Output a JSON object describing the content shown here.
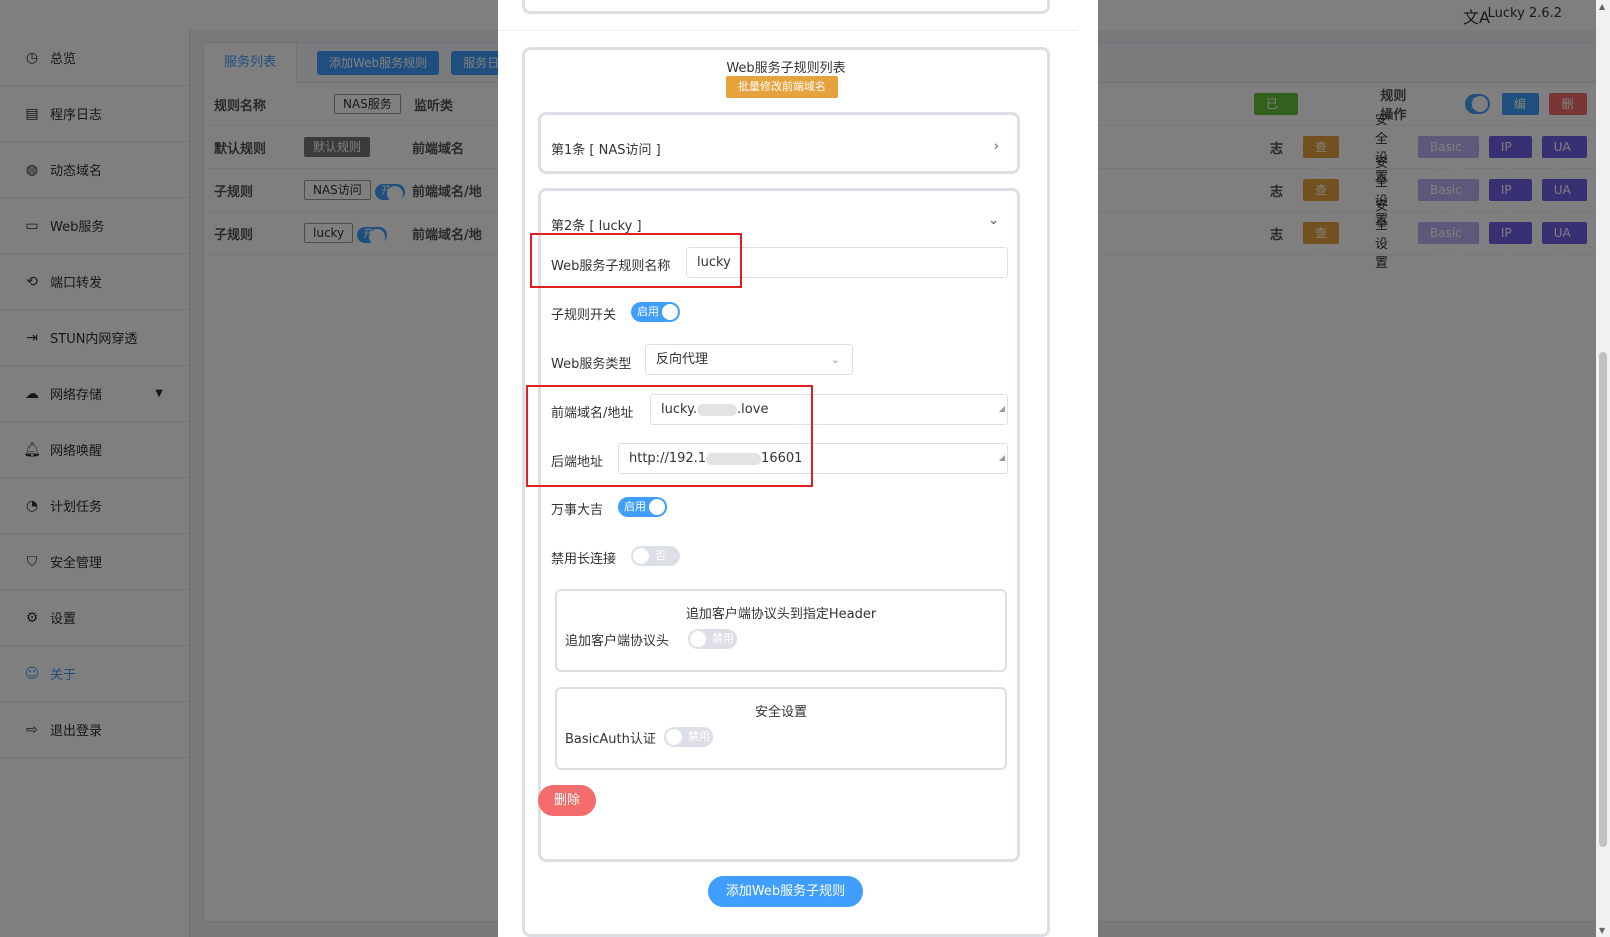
{
  "topbar": {
    "lang_icon": "translate-icon",
    "version": "Lucky 2.6.2"
  },
  "sidebar": {
    "items": [
      {
        "label": "总览",
        "icon": "dashboard-icon"
      },
      {
        "label": "程序日志",
        "icon": "log-icon"
      },
      {
        "label": "动态域名",
        "icon": "globe-icon"
      },
      {
        "label": "Web服务",
        "icon": "web-icon"
      },
      {
        "label": "端口转发",
        "icon": "forward-icon"
      },
      {
        "label": "STUN内网穿透",
        "icon": "stun-icon"
      },
      {
        "label": "网络存储",
        "icon": "cloud-icon"
      },
      {
        "label": "网络唤醒",
        "icon": "bell-icon"
      },
      {
        "label": "计划任务",
        "icon": "clock-icon"
      },
      {
        "label": "安全管理",
        "icon": "shield-icon"
      },
      {
        "label": "设置",
        "icon": "gear-icon"
      },
      {
        "label": "关于",
        "icon": "about-icon"
      },
      {
        "label": "退出登录",
        "icon": "logout-icon"
      }
    ]
  },
  "background": {
    "tabs": {
      "list": "服务列表",
      "add": "添加Web服务规则",
      "third": "服务日"
    },
    "header": {
      "rule_name": "规则名称",
      "tag": "NAS服务",
      "listen": "监听类",
      "enabled": "已启用",
      "rule_ops": "规则操作",
      "switch": "开",
      "edit": "编辑",
      "delete": "删除"
    },
    "rows": [
      {
        "type": "默认规则",
        "tag": "默认规则",
        "switch": "",
        "field": "前端域名",
        "log": "志",
        "view": "查看",
        "security": "安全设置",
        "basic": "Basic认证未启用",
        "ip": "IP黑名单",
        "ua": "UA黑名单"
      },
      {
        "type": "子规则",
        "tag": "NAS访问",
        "switch": "开",
        "field": "前端域名/地",
        "log": "志",
        "view": "查看",
        "security": "安全设置",
        "basic": "Basic认证未启用",
        "ip": "IP黑名单",
        "ua": "UA黑名单"
      },
      {
        "type": "子规则",
        "tag": "lucky",
        "switch": "开",
        "field": "前端域名/地",
        "log": "志",
        "view": "查看",
        "security": "安全设置",
        "basic": "Basic认证未启用",
        "ip": "IP黑名单",
        "ua": "UA黑名单"
      }
    ]
  },
  "dialog": {
    "list_title": "Web服务子规则列表",
    "batch_edit": "批量修改前端域名",
    "item1": {
      "title": "第1条 [ NAS访问 ]"
    },
    "item2": {
      "title": "第2条 [ lucky ]",
      "name_label": "Web服务子规则名称",
      "name_value": "lucky",
      "switch_label": "子规则开关",
      "switch_state": "启用",
      "type_label": "Web服务类型",
      "type_value": "反向代理",
      "frontend_label": "前端域名/地址",
      "frontend_prefix": "lucky.",
      "frontend_suffix": ".love",
      "backend_label": "后端地址",
      "backend_prefix": "http://192.1",
      "backend_suffix": "16601",
      "wanshi_label": "万事大吉",
      "wanshi_state": "启用",
      "keepalive_label": "禁用长连接",
      "keepalive_state": "否",
      "header_box_title": "追加客户端协议头到指定Header",
      "header_label": "追加客户端协议头",
      "header_state": "禁用",
      "security_title": "安全设置",
      "basic_label": "BasicAuth认证",
      "basic_state": "禁用",
      "delete": "删除"
    },
    "add_sub_rule": "添加Web服务子规则"
  }
}
